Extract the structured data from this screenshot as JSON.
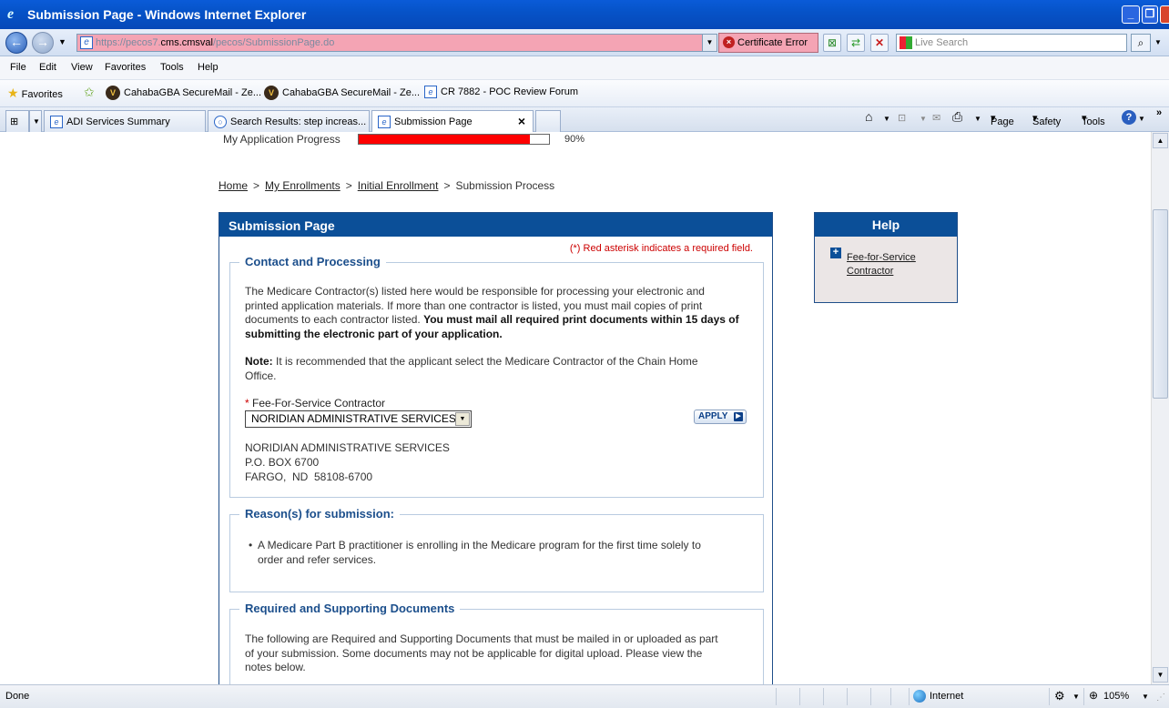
{
  "window": {
    "title": "Submission Page - Windows Internet Explorer"
  },
  "address": {
    "url_pre": "https://pecos7.",
    "url_host": "cms.cmsval",
    "url_post": "/pecos/SubmissionPage.do",
    "cert_error": "Certificate Error",
    "search_placeholder": "Live Search"
  },
  "menu": [
    "File",
    "Edit",
    "View",
    "Favorites",
    "Tools",
    "Help"
  ],
  "favorites": {
    "label": "Favorites",
    "items": [
      "CahabaGBA SecureMail - Ze...",
      "CahabaGBA SecureMail - Ze...",
      "CR 7882 - POC Review Forum"
    ]
  },
  "tabs": [
    {
      "label": "ADI Services Summary"
    },
    {
      "label": "Search Results: step increas..."
    },
    {
      "label": "Submission Page"
    }
  ],
  "command_bar": {
    "page": "Page",
    "safety": "Safety",
    "tools": "Tools"
  },
  "progress": {
    "label": "My Application Progress",
    "value": 0.9,
    "text": "90%"
  },
  "breadcrumb": {
    "home": "Home",
    "enrollments": "My Enrollments",
    "initial": "Initial Enrollment",
    "current": "Submission Process",
    "sep": ">"
  },
  "panel": {
    "title": "Submission Page",
    "required_note": "(*) Red asterisk indicates a required field.",
    "contact": {
      "legend": "Contact and Processing",
      "p1_line1": "The Medicare Contractor(s) listed here would be responsible for processing your electronic and",
      "p1_line2": "printed application materials. If more than one contractor is listed, you must mail copies of print",
      "p1_line3a": "documents to each contractor listed. ",
      "p1_line3b": "You must mail all required print documents within 15 days of",
      "p1_line4": "submitting the electronic part of your application.",
      "note_label": "Note:",
      "note_line1": " It is recommended that the applicant select the Medicare Contractor of the Chain Home",
      "note_line2": "Office.",
      "field_label": "Fee-For-Service Contractor",
      "field_asterisk": "*",
      "field_value": "NORIDIAN ADMINISTRATIVE SERVICES",
      "apply_label": "APPLY",
      "addr1": "NORIDIAN ADMINISTRATIVE SERVICES",
      "addr2": "P.O. BOX 6700",
      "addr3": "FARGO,  ND  58108-6700"
    },
    "reasons": {
      "legend": "Reason(s) for submission:",
      "bullet_line1": "A Medicare Part B practitioner is enrolling in the Medicare program for the first time solely to",
      "bullet_line2": "order and refer services."
    },
    "documents": {
      "legend": "Required and Supporting Documents",
      "line1": "The following are Required and Supporting Documents that must be mailed in or uploaded as part",
      "line2": "of your submission. Some documents may not be applicable for digital upload. Please view the",
      "line3": "notes below."
    }
  },
  "help": {
    "title": "Help",
    "link_line1": "Fee-for-Service",
    "link_line2": "Contractor"
  },
  "status": {
    "left": "Done",
    "zone": "Internet",
    "zoom": "105%"
  }
}
